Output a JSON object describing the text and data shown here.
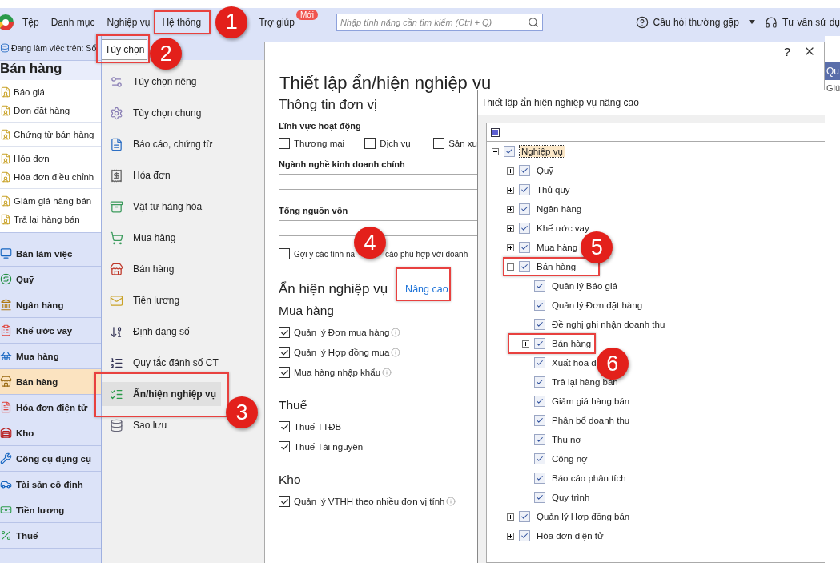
{
  "menubar": {
    "items": [
      {
        "label": "Tệp"
      },
      {
        "label": "Danh mục"
      },
      {
        "label": "Nghiệp vụ"
      },
      {
        "label": "Hệ thống"
      },
      {
        "label": "Trợ giúp",
        "badge": "Mới"
      }
    ],
    "search": {
      "placeholder": "Nhập tính năng cần tìm kiếm (Ctrl + Q)"
    },
    "help": "Câu hỏi thường gặp",
    "support": "Tư vấn sử dụ"
  },
  "workspace": "Đang làm việc trên: Sổ",
  "sidebar": {
    "title": "Bán hàng",
    "groups": [
      [
        "Báo giá",
        "Đơn đặt hàng"
      ],
      [
        "Chứng từ bán hàng"
      ],
      [
        "Hóa đơn",
        "Hóa đơn điều chỉnh"
      ],
      [
        "Giảm giá hàng bán",
        "Trả lại hàng bán"
      ]
    ],
    "modules": [
      {
        "label": "Bàn làm việc",
        "selected": false
      },
      {
        "label": "Quỹ",
        "selected": false
      },
      {
        "label": "Ngân hàng",
        "selected": false
      },
      {
        "label": "Khế ước vay",
        "selected": false
      },
      {
        "label": "Mua hàng",
        "selected": false
      },
      {
        "label": "Bán hàng",
        "selected": true
      },
      {
        "label": "Hóa đơn điện tử",
        "selected": false
      },
      {
        "label": "Kho",
        "selected": false
      },
      {
        "label": "Công cụ dụng cụ",
        "selected": false
      },
      {
        "label": "Tài sản cố định",
        "selected": false
      },
      {
        "label": "Tiền lương",
        "selected": false
      },
      {
        "label": "Thuế",
        "selected": false
      }
    ]
  },
  "options_menu": {
    "title": "Tùy chọn",
    "items": [
      {
        "label": "Tùy chọn riêng",
        "selected": false
      },
      {
        "label": "Tùy chọn chung",
        "selected": false
      },
      {
        "label": "Báo cáo, chứng từ",
        "selected": false
      },
      {
        "label": "Hóa đơn",
        "selected": false
      },
      {
        "label": "Vật tư hàng hóa",
        "selected": false
      },
      {
        "label": "Mua hàng",
        "selected": false
      },
      {
        "label": "Bán hàng",
        "selected": false
      },
      {
        "label": "Tiền lương",
        "selected": false
      },
      {
        "label": "Định dạng số",
        "selected": false
      },
      {
        "label": "Quy tắc đánh số CT",
        "selected": false
      },
      {
        "label": "Ẩn/hiện nghiệp vụ",
        "selected": true
      },
      {
        "label": "Sao lưu",
        "selected": false
      }
    ]
  },
  "dialog": {
    "help": "?",
    "title": "Thiết lập ẩn/hiện nghiệp vụ",
    "section": "Thông tin đơn vị",
    "activity": {
      "label": "Lĩnh vực hoạt động",
      "options": [
        {
          "label": "Thương mại",
          "checked": false
        },
        {
          "label": "Dịch vụ",
          "checked": false
        },
        {
          "label": "Sản xu",
          "checked": false
        }
      ]
    },
    "industry": {
      "label": "Ngành nghề kinh doanh chính"
    },
    "capital": {
      "label": "Tổng nguồn vốn"
    },
    "suggest": {
      "parts": [
        "Gợi ý các tính nă",
        "cáo phù hợp với doanh"
      ],
      "checked": false
    },
    "visibility": {
      "title": "Ẩn hiện nghiệp vụ",
      "link": "Nâng cao",
      "groups": [
        {
          "title": "Mua hàng",
          "items": [
            {
              "label": "Quản lý Đơn mua hàng",
              "checked": true,
              "info": true
            },
            {
              "label": "Quản lý Hợp đồng mua",
              "checked": true,
              "info": true
            },
            {
              "label": "Mua hàng nhập khẩu",
              "checked": true,
              "info": true
            }
          ]
        },
        {
          "title": "Thuế",
          "items": [
            {
              "label": "Thuế TTĐB",
              "checked": true,
              "info": false
            },
            {
              "label": "Thuế Tài nguyên",
              "checked": true,
              "info": false
            }
          ]
        },
        {
          "title": "Kho",
          "items": [
            {
              "label": "Quản lý VTHH theo nhiều đơn vị tính",
              "checked": true,
              "info": true
            }
          ]
        }
      ]
    }
  },
  "advanced": {
    "title": "Thiết lập ẩn hiện nghiệp vụ nâng cao",
    "tree": [
      {
        "label": "Nghiệp vụ",
        "checked": true,
        "selected": true,
        "expanded": true,
        "children": [
          {
            "label": "Quỹ",
            "checked": true,
            "selected": false,
            "expanded": false
          },
          {
            "label": "Thủ quỹ",
            "checked": true,
            "selected": false,
            "expanded": false
          },
          {
            "label": "Ngân hàng",
            "checked": true,
            "selected": false,
            "expanded": false
          },
          {
            "label": "Khế ước vay",
            "checked": true,
            "selected": false,
            "expanded": false
          },
          {
            "label": "Mua hàng",
            "checked": true,
            "selected": false,
            "expanded": false
          },
          {
            "label": "Bán hàng",
            "checked": true,
            "selected": false,
            "expanded": true,
            "children": [
              {
                "label": "Quản lý Báo giá",
                "checked": true,
                "selected": false
              },
              {
                "label": "Quản lý Đơn đặt hàng",
                "checked": true,
                "selected": false
              },
              {
                "label": "Đề nghị ghi nhận doanh thu",
                "checked": true,
                "selected": false
              },
              {
                "label": "Bán hàng",
                "checked": true,
                "selected": false,
                "expanded": false
              },
              {
                "label": "Xuất hóa đ",
                "checked": true,
                "selected": false
              },
              {
                "label": "Trả lại hàng bán",
                "checked": true,
                "selected": false
              },
              {
                "label": "Giảm giá hàng bán",
                "checked": true,
                "selected": false
              },
              {
                "label": "Phân bổ doanh thu",
                "checked": true,
                "selected": false
              },
              {
                "label": "Thu nợ",
                "checked": true,
                "selected": false
              },
              {
                "label": "Công nợ",
                "checked": true,
                "selected": false
              },
              {
                "label": "Báo cáo phân tích",
                "checked": true,
                "selected": false
              },
              {
                "label": "Quy trình",
                "checked": true,
                "selected": false
              }
            ]
          },
          {
            "label": "Quản lý Hợp đồng bán",
            "checked": true,
            "selected": false,
            "expanded": false
          },
          {
            "label": "Hóa đơn điện tử",
            "checked": true,
            "selected": false,
            "expanded": false
          }
        ]
      }
    ]
  },
  "right_strip": {
    "tab": "Qu",
    "item": "Giú"
  },
  "callouts": [
    "1",
    "2",
    "3",
    "4",
    "5",
    "6"
  ]
}
